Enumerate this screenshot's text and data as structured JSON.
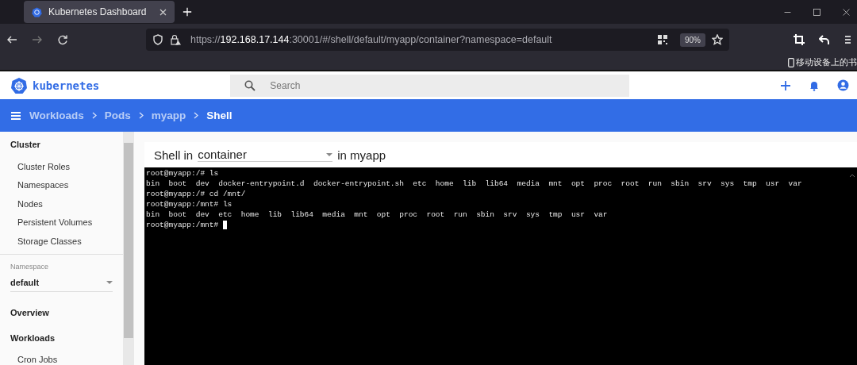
{
  "browser": {
    "tab": {
      "title": "Kubernetes Dashboard",
      "selected": true
    },
    "url": {
      "scheme": "https://",
      "host": "192.168.17.144",
      "rest": ":30001/#/shell/default/myapp/container?namespace=default"
    },
    "zoom": "90%",
    "bookmark": "移动设备上的书"
  },
  "header": {
    "logo": "kubernetes",
    "search": {
      "placeholder": "Search"
    }
  },
  "breadcrumbs": [
    {
      "label": "Workloads",
      "selected": false
    },
    {
      "label": "Pods",
      "selected": false
    },
    {
      "label": "myapp",
      "selected": false
    },
    {
      "label": "Shell",
      "selected": true
    }
  ],
  "sidebar": {
    "items": [
      {
        "kind": "header",
        "label": "Cluster"
      },
      {
        "kind": "item",
        "label": "Cluster Roles"
      },
      {
        "kind": "item",
        "label": "Namespaces"
      },
      {
        "kind": "item",
        "label": "Nodes"
      },
      {
        "kind": "item",
        "label": "Persistent Volumes"
      },
      {
        "kind": "item",
        "label": "Storage Classes"
      },
      {
        "kind": "namespace",
        "label": "Namespace",
        "value": "default"
      },
      {
        "kind": "header",
        "label": "Overview"
      },
      {
        "kind": "header",
        "label": "Workloads"
      },
      {
        "kind": "item",
        "label": "Cron Jobs"
      }
    ]
  },
  "shell": {
    "title": "Shell in",
    "container": "container",
    "pod": "in myapp",
    "lines": [
      "root@myapp:/# ls",
      "bin  boot  dev  docker-entrypoint.d  docker-entrypoint.sh  etc  home  lib  lib64  media  mnt  opt  proc  root  run  sbin  srv  sys  tmp  usr  var",
      "root@myapp:/# cd /mnt/",
      "root@myapp:/mnt# ls",
      "bin  boot  dev  etc  home  lib  lib64  media  mnt  opt  proc  root  run  sbin  srv  sys  tmp  usr  var",
      "root@myapp:/mnt# "
    ]
  }
}
